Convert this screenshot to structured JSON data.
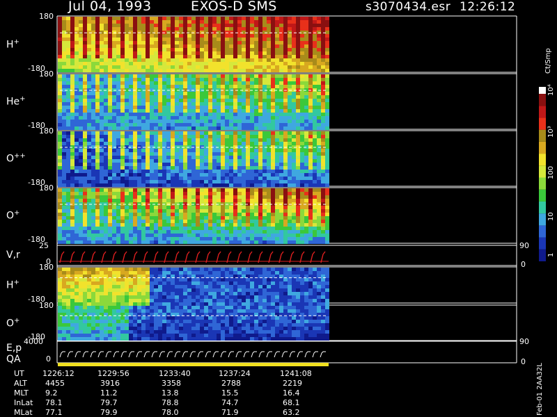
{
  "header": {
    "date": "Jul 04, 1993",
    "instrument": "EXOS-D SMS",
    "file": "s3070434.esr",
    "time": "12:26:12"
  },
  "chart_data": {
    "type": "heatmap",
    "panels": [
      {
        "id": "hp1",
        "label": "H",
        "sup": "+",
        "ylim": [
          -180,
          180
        ],
        "ticks": [
          "180",
          "-180"
        ]
      },
      {
        "id": "hep",
        "label": "He",
        "sup": "+",
        "ylim": [
          -180,
          180
        ],
        "ticks": [
          "180",
          "-180"
        ]
      },
      {
        "id": "opp",
        "label": "O",
        "sup": "++",
        "ylim": [
          -180,
          180
        ],
        "ticks": [
          "180",
          "-180"
        ]
      },
      {
        "id": "op1",
        "label": "O",
        "sup": "+",
        "ylim": [
          -180,
          180
        ],
        "ticks": [
          "180",
          "-180"
        ]
      },
      {
        "id": "vr",
        "label": "V,r",
        "sup": "",
        "ylim": [
          0,
          25
        ],
        "ticks": [
          "25",
          "0"
        ],
        "right_ticks": [
          "90",
          "0"
        ]
      },
      {
        "id": "hp2",
        "label": "H",
        "sup": "+",
        "ylim": [
          -180,
          180
        ],
        "ticks": [
          "180",
          "-180"
        ]
      },
      {
        "id": "op2",
        "label": "O",
        "sup": "+",
        "ylim": [
          -180,
          180
        ],
        "ticks": [
          "180",
          "-180"
        ]
      },
      {
        "id": "ep",
        "label": "E,p",
        "sup": "",
        "label2": "QA",
        "ylim": [
          0,
          4000
        ],
        "ticks": [
          "4000",
          "0"
        ],
        "right_ticks": [
          "90",
          "0"
        ]
      }
    ],
    "colorbar": {
      "unit": "Ct/Smp",
      "tick_labels": [
        "1",
        "10",
        "100",
        "10³",
        "10⁴"
      ],
      "scale": "log",
      "range": [
        1,
        10000
      ]
    },
    "ephemeris": {
      "rows": [
        {
          "name": "UT",
          "values": [
            "1226:12",
            "1229:56",
            "1233:40",
            "1237:24",
            "1241:08"
          ]
        },
        {
          "name": "ALT",
          "values": [
            "4455",
            "3916",
            "3358",
            "2788",
            "2219"
          ]
        },
        {
          "name": "MLT",
          "values": [
            "9.2",
            "11.2",
            "13.8",
            "15.5",
            "16.4"
          ]
        },
        {
          "name": "InLat",
          "values": [
            "78.1",
            "79.7",
            "78.8",
            "74.7",
            "68.1"
          ]
        },
        {
          "name": "MLat",
          "values": [
            "77.1",
            "79.9",
            "78.0",
            "71.9",
            "63.2"
          ]
        }
      ]
    },
    "footer_stamp": "Feb-01 2AA32L"
  }
}
